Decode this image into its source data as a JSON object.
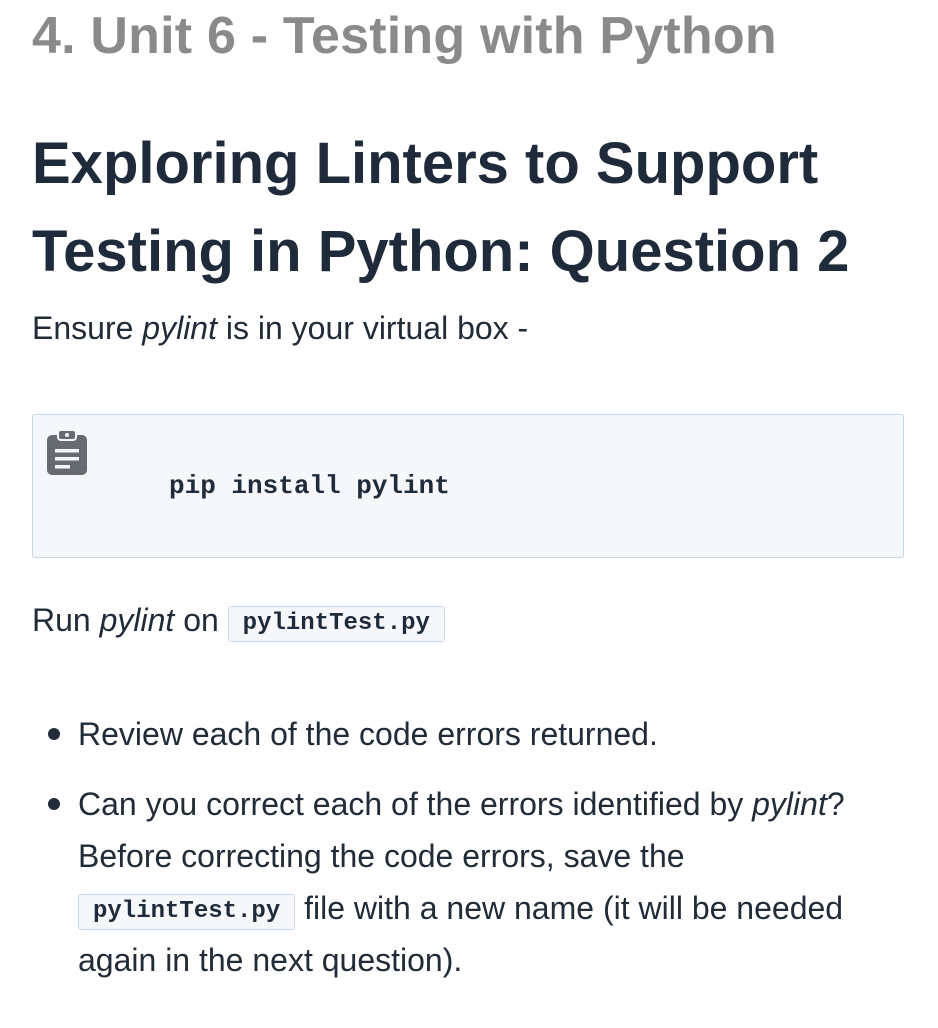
{
  "unit_title": "4. Unit 6 - Testing with Python",
  "page_title": "Exploring Linters to Support Testing in Python: Question 2",
  "intro": {
    "prefix": "Ensure ",
    "tool": "pylint",
    "suffix": " is in your virtual box -"
  },
  "code_block": {
    "icon": "clipboard-icon",
    "code": "pip install pylint"
  },
  "run_line": {
    "prefix": "Run ",
    "tool": "pylint",
    "middle": " on ",
    "file": "pylintTest.py"
  },
  "bullets": {
    "item1": "Review each of the code errors returned.",
    "item2_part1": "Can you correct each of the errors identified by ",
    "item2_tool": "pylint",
    "item2_part2": "? Before correcting the code errors, save the ",
    "item2_file": "pylintTest.py",
    "item2_part3": " file with a new name (it will be needed again in the next question)."
  },
  "colors": {
    "unit_title": "#8a8a8a",
    "heading": "#1f2a3a",
    "body_text": "#222b38",
    "code_bg": "#f6f7fb",
    "code_border": "#c9d6ec",
    "icon": "#666b72"
  }
}
